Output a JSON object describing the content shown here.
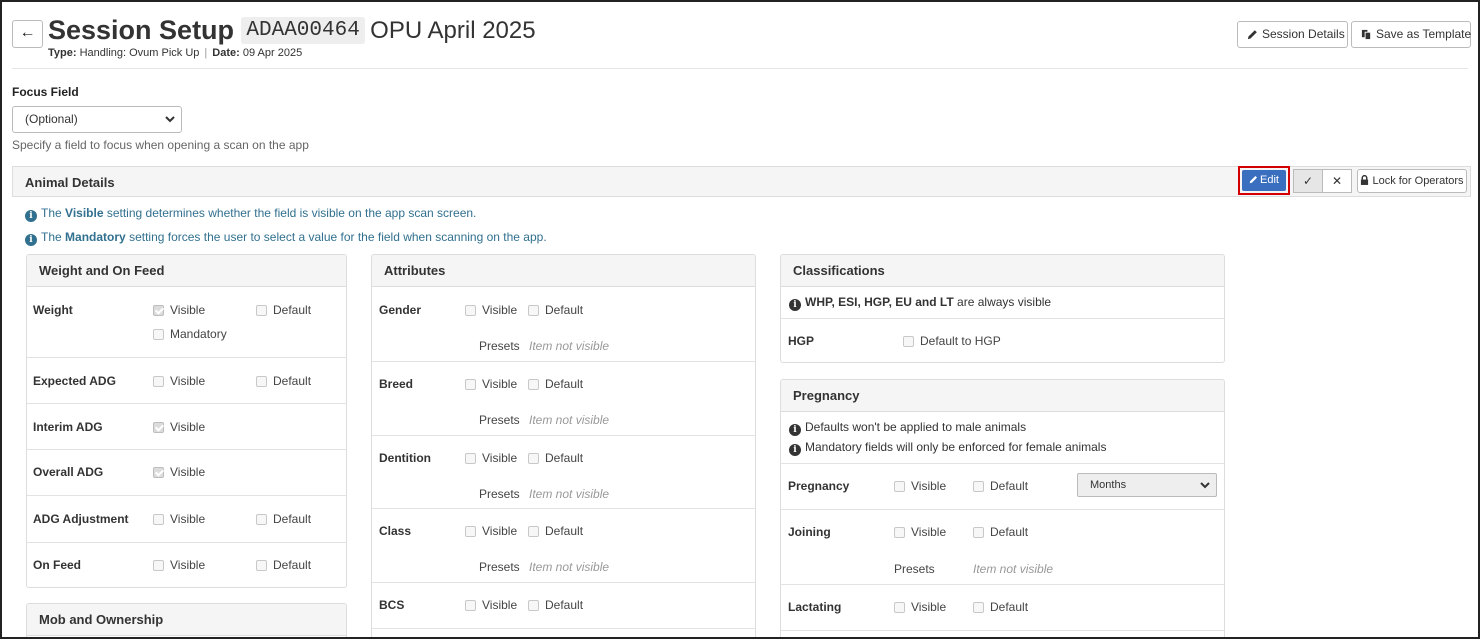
{
  "header": {
    "title": "Session Setup",
    "code": "ADAA00464",
    "subtitle": "OPU April 2025",
    "type_label": "Type:",
    "type_value": "Handling: Ovum Pick Up",
    "date_label": "Date:",
    "date_value": "09 Apr 2025",
    "back_glyph": "←",
    "session_details_label": "Session Details",
    "save_template_label": "Save as Template"
  },
  "focus": {
    "label": "Focus Field",
    "selected": "(Optional)",
    "help": "Specify a field to focus when opening a scan on the app"
  },
  "panel": {
    "title": "Animal Details",
    "edit_label": "Edit",
    "confirm_glyph": "✓",
    "cancel_glyph": "✕",
    "lock_label": "Lock for Operators"
  },
  "info": {
    "visible_pre": "The",
    "visible_word": "Visible",
    "visible_post": "setting determines whether the field is visible on the app scan screen.",
    "mandatory_pre": "The",
    "mandatory_word": "Mandatory",
    "mandatory_post": "setting forces the user to select a value for the field when scanning on the app."
  },
  "weight_card": {
    "title": "Weight and On Feed",
    "rows": [
      {
        "label": "Weight",
        "visible": "Visible",
        "mandatory": "Mandatory",
        "default": "Default"
      },
      {
        "label": "Expected ADG",
        "visible": "Visible",
        "default": "Default"
      },
      {
        "label": "Interim ADG",
        "visible": "Visible"
      },
      {
        "label": "Overall ADG",
        "visible": "Visible"
      },
      {
        "label": "ADG Adjustment",
        "visible": "Visible",
        "default": "Default"
      },
      {
        "label": "On Feed",
        "visible": "Visible",
        "default": "Default"
      }
    ]
  },
  "mob_card": {
    "title": "Mob and Ownership"
  },
  "attributes_card": {
    "title": "Attributes",
    "presets_label": "Presets",
    "not_visible": "Item not visible",
    "rows": [
      {
        "label": "Gender",
        "visible": "Visible",
        "default": "Default"
      },
      {
        "label": "Breed",
        "visible": "Visible",
        "default": "Default"
      },
      {
        "label": "Dentition",
        "visible": "Visible",
        "default": "Default"
      },
      {
        "label": "Class",
        "visible": "Visible",
        "default": "Default"
      },
      {
        "label": "BCS",
        "visible": "Visible",
        "default": "Default"
      }
    ]
  },
  "classifications_card": {
    "title": "Classifications",
    "note_bold": "WHP, ESI, HGP, EU and LT",
    "note_rest": "are always visible",
    "hgp_label": "HGP",
    "hgp_default": "Default to HGP"
  },
  "pregnancy_card": {
    "title": "Pregnancy",
    "note1": "Defaults won't be applied to male animals",
    "note2": "Mandatory fields will only be enforced for female animals",
    "presets_label": "Presets",
    "not_visible": "Item not visible",
    "months": "Months",
    "rows": [
      {
        "label": "Pregnancy",
        "visible": "Visible",
        "default": "Default"
      },
      {
        "label": "Joining",
        "visible": "Visible",
        "default": "Default"
      },
      {
        "label": "Lactating",
        "visible": "Visible",
        "default": "Default"
      }
    ]
  },
  "colors": {
    "edit_button": "#3a6ebf",
    "highlight": "#d40000",
    "info_text": "#31708f"
  }
}
